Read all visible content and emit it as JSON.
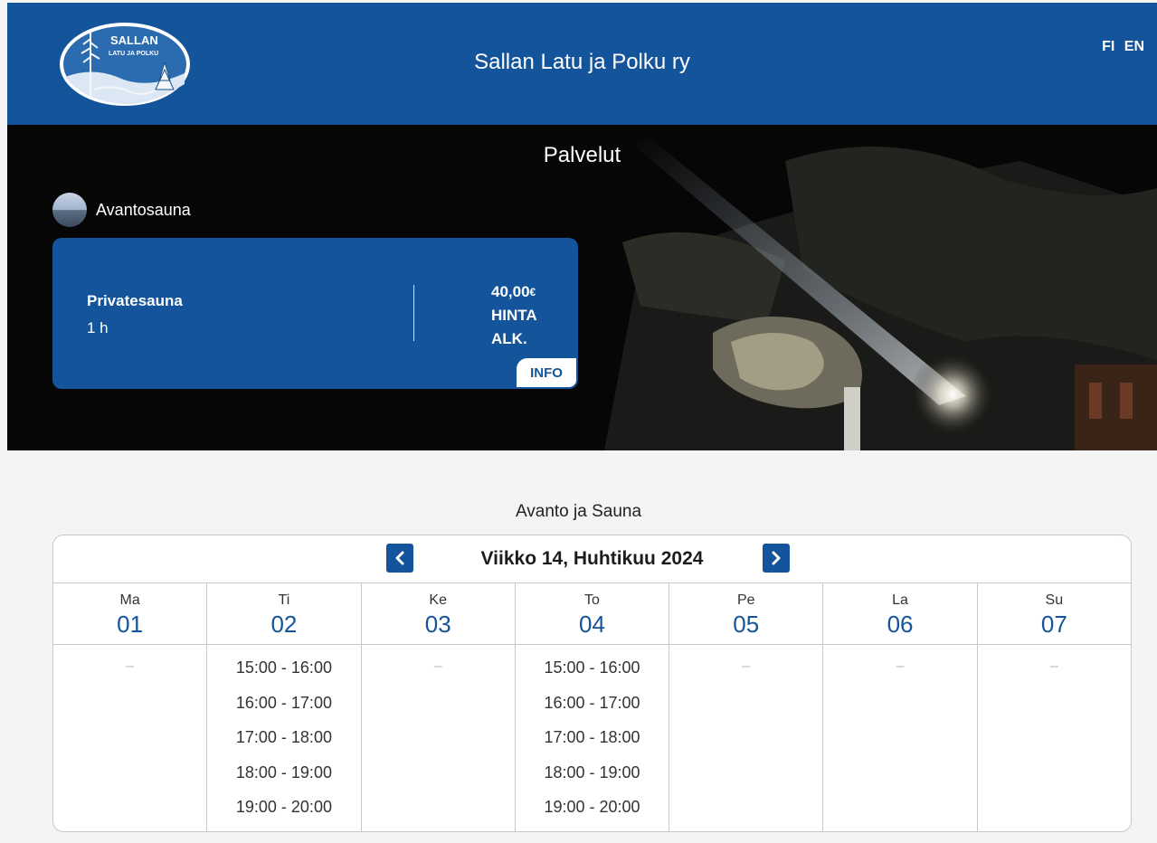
{
  "header": {
    "title": "Sallan Latu ja Polku ry",
    "logo_text_main": "SALLAN",
    "logo_text_sub": "LATU JA POLKU",
    "languages": [
      "FI",
      "EN"
    ]
  },
  "hero": {
    "title": "Palvelut",
    "service_name": "Avantosauna",
    "card": {
      "name": "Privatesauna",
      "duration": "1 h",
      "price": "40,00",
      "currency": "€",
      "price_label_1": "HINTA",
      "price_label_2": "ALK.",
      "info_label": "INFO"
    }
  },
  "calendar": {
    "section_title": "Avanto ja Sauna",
    "week_label": "Viikko 14, Huhtikuu 2024",
    "empty_marker": "–",
    "days": [
      {
        "name": "Ma",
        "num": "01",
        "slots": []
      },
      {
        "name": "Ti",
        "num": "02",
        "slots": [
          "15:00 - 16:00",
          "16:00 - 17:00",
          "17:00 - 18:00",
          "18:00 - 19:00",
          "19:00 - 20:00"
        ]
      },
      {
        "name": "Ke",
        "num": "03",
        "slots": []
      },
      {
        "name": "To",
        "num": "04",
        "slots": [
          "15:00 - 16:00",
          "16:00 - 17:00",
          "17:00 - 18:00",
          "18:00 - 19:00",
          "19:00 - 20:00"
        ]
      },
      {
        "name": "Pe",
        "num": "05",
        "slots": []
      },
      {
        "name": "La",
        "num": "06",
        "slots": []
      },
      {
        "name": "Su",
        "num": "07",
        "slots": []
      }
    ]
  },
  "colors": {
    "primary": "#14549a",
    "background": "#f4f4f4"
  }
}
